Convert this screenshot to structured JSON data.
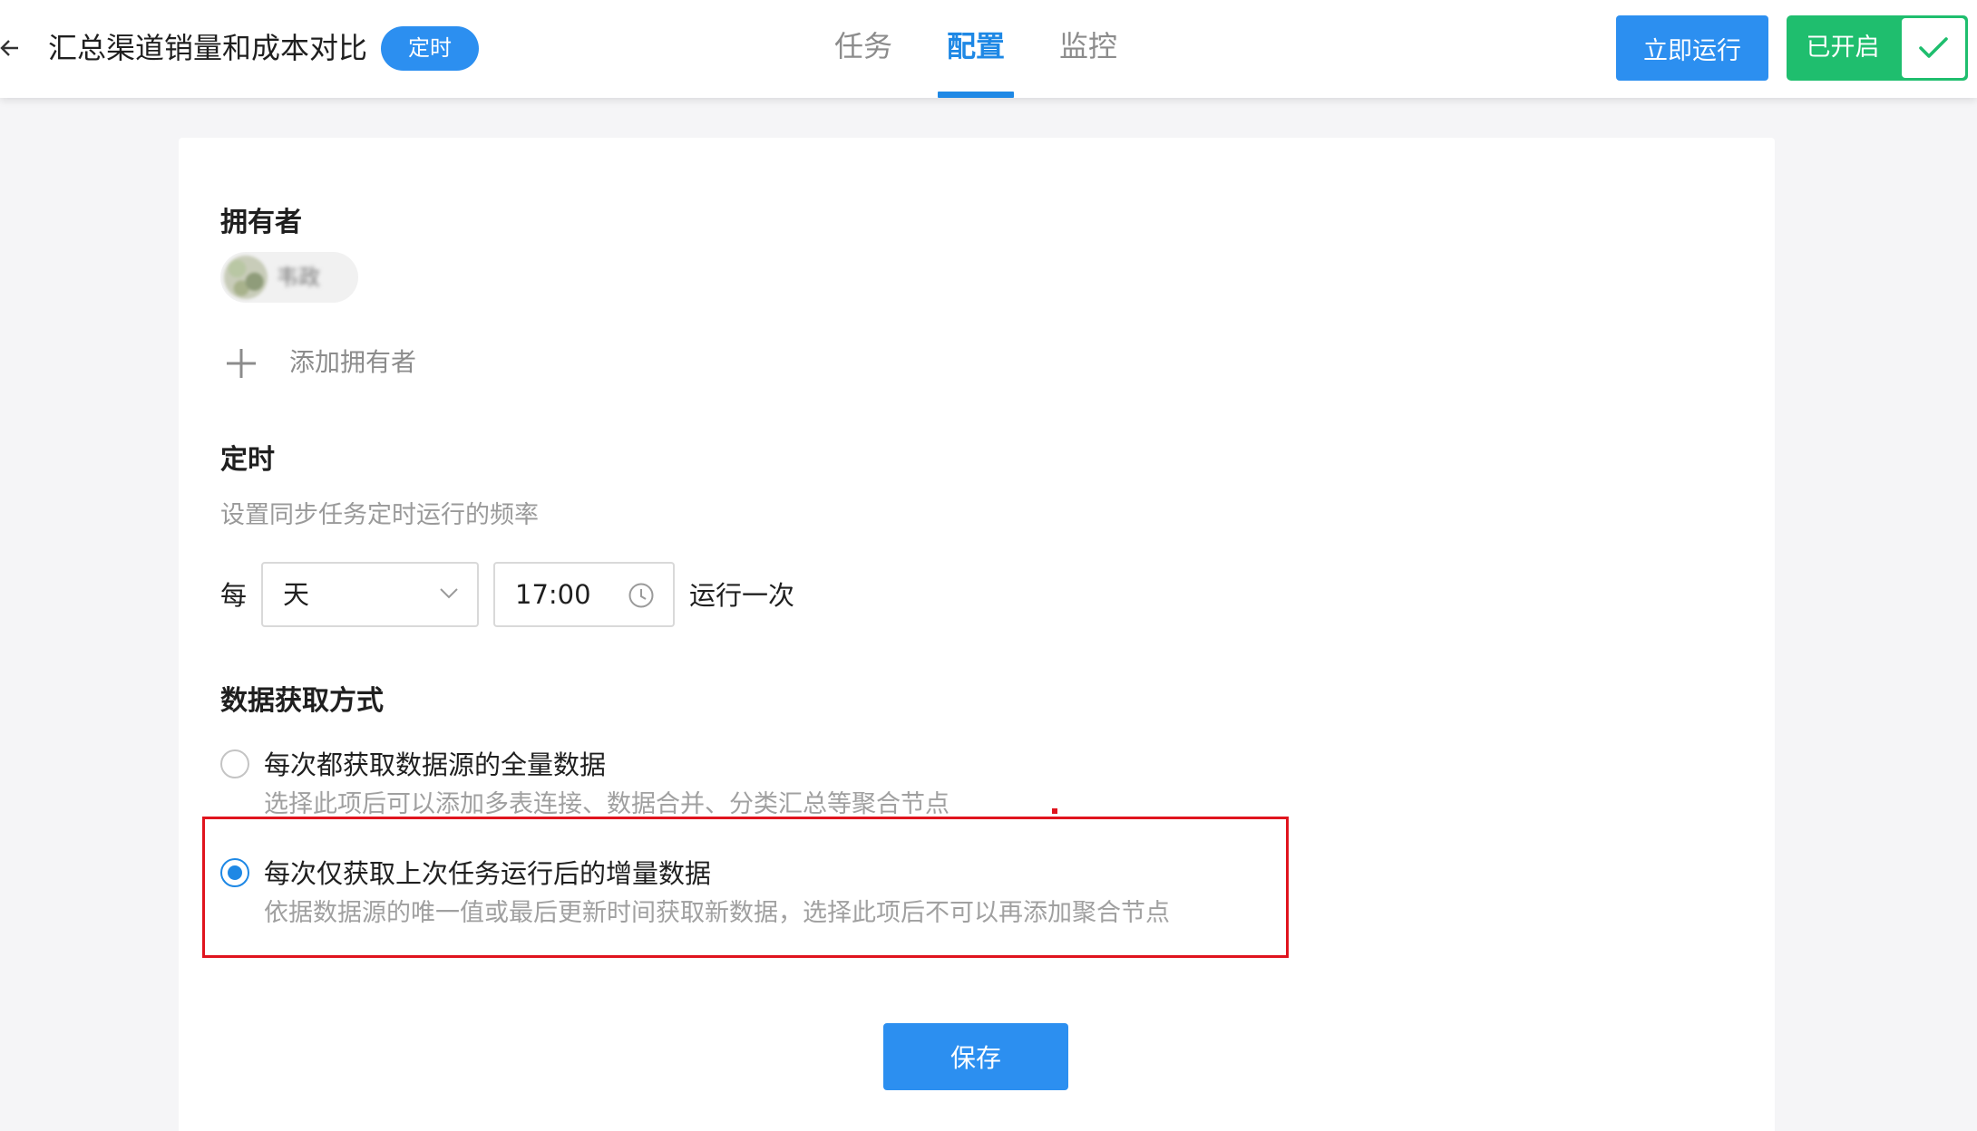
{
  "header": {
    "title": "汇总渠道销量和成本对比",
    "badge": "定时",
    "tabs": [
      {
        "label": "任务"
      },
      {
        "label": "配置"
      },
      {
        "label": "监控"
      }
    ],
    "active_tab": "配置",
    "run_button": "立即运行",
    "enable_toggle": {
      "label": "已开启",
      "on": true
    }
  },
  "owner": {
    "title": "拥有者",
    "owner_name": "韦政",
    "add_label": "添加拥有者"
  },
  "schedule": {
    "title": "定时",
    "description": "设置同步任务定时运行的频率",
    "every_label": "每",
    "period": "天",
    "time": "17:00",
    "suffix": "运行一次"
  },
  "fetch_mode": {
    "title": "数据获取方式",
    "options": [
      {
        "label": "每次都获取数据源的全量数据",
        "description": "选择此项后可以添加多表连接、数据合并、分类汇总等聚合节点",
        "checked": false
      },
      {
        "label": "每次仅获取上次任务运行后的增量数据",
        "description": "依据数据源的唯一值或最后更新时间获取新数据，选择此项后不可以再添加聚合节点",
        "checked": true
      }
    ]
  },
  "save_button": "保存",
  "colors": {
    "primary": "#2c8ff0",
    "success": "#1fbe6e",
    "highlight": "#e0141e"
  }
}
